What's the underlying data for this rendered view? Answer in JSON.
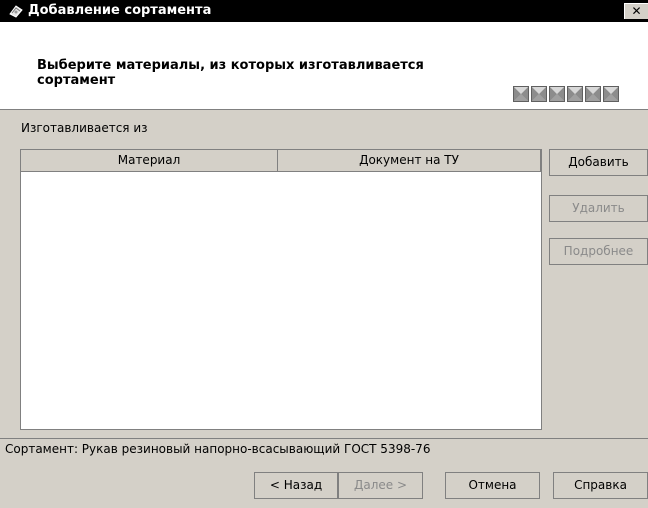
{
  "window": {
    "title": "Добавление сортамента",
    "close_label": "✕"
  },
  "header": {
    "heading": "Выберите материалы, из которых изготавливается сортамент",
    "progress_total": 6,
    "progress_current": 0
  },
  "section": {
    "label": "Изготавливается из"
  },
  "list": {
    "columns": [
      "Материал",
      "Документ на ТУ"
    ],
    "rows": []
  },
  "side_buttons": {
    "add": "Добавить",
    "delete": "Удалить",
    "details": "Подробнее"
  },
  "status": {
    "text": "Сортамент: Рукав резиновый напорно-всасывающий ГОСТ 5398-76"
  },
  "footer": {
    "back": "< Назад",
    "next": "Далее >",
    "cancel": "Отмена",
    "help": "Справка"
  },
  "colors": {
    "titlebar": "#000000",
    "window": "#d4d0c8",
    "panel": "#ffffff"
  }
}
